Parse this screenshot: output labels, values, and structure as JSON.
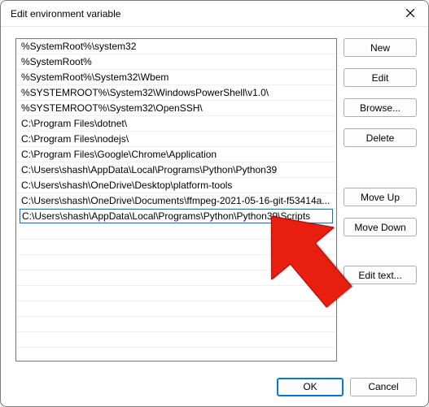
{
  "window": {
    "title": "Edit environment variable"
  },
  "list": {
    "items": [
      "%SystemRoot%\\system32",
      "%SystemRoot%",
      "%SystemRoot%\\System32\\Wbem",
      "%SYSTEMROOT%\\System32\\WindowsPowerShell\\v1.0\\",
      "%SYSTEMROOT%\\System32\\OpenSSH\\",
      "C:\\Program Files\\dotnet\\",
      "C:\\Program Files\\nodejs\\",
      "C:\\Program Files\\Google\\Chrome\\Application",
      "C:\\Users\\shash\\AppData\\Local\\Programs\\Python\\Python39",
      "C:\\Users\\shash\\OneDrive\\Desktop\\platform-tools",
      "C:\\Users\\shash\\OneDrive\\Documents\\ffmpeg-2021-05-16-git-f53414a..."
    ],
    "editing_value": "C:\\Users\\shash\\AppData\\Local\\Programs\\Python\\Python39\\Scripts",
    "editing_index": 11
  },
  "buttons": {
    "new": "New",
    "edit": "Edit",
    "browse": "Browse...",
    "delete": "Delete",
    "move_up": "Move Up",
    "move_down": "Move Down",
    "edit_text": "Edit text...",
    "ok": "OK",
    "cancel": "Cancel"
  },
  "colors": {
    "accent": "#0078d7",
    "arrow": "#e81e0f"
  }
}
